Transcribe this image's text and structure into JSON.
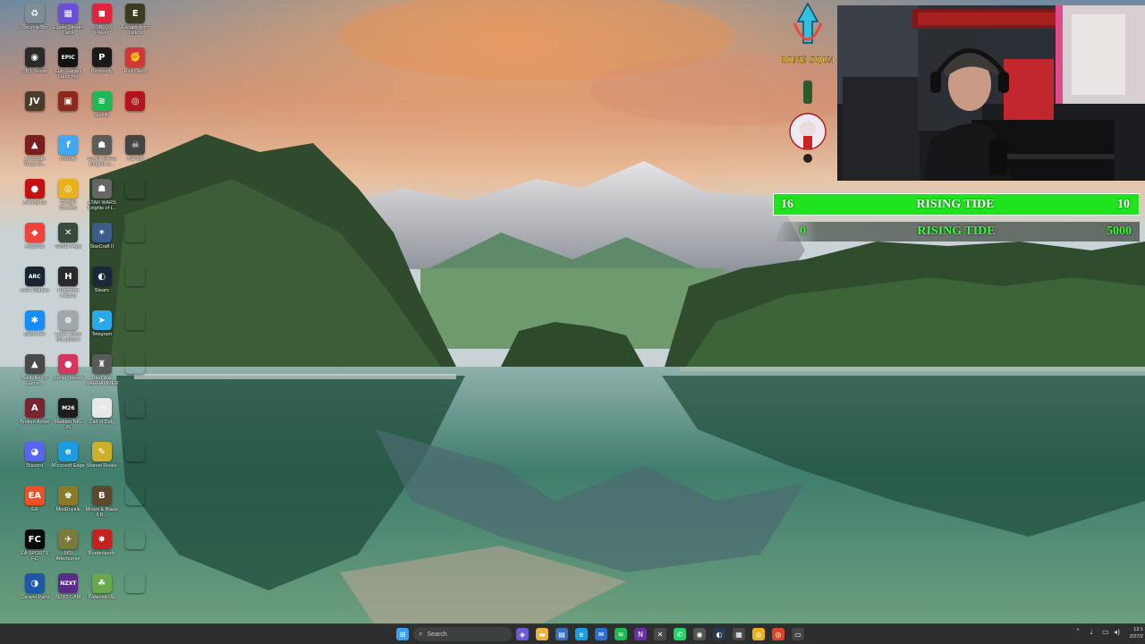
{
  "desktop": {
    "icons": [
      {
        "label": "Recycle Bin",
        "icon": "recycle-bin-icon",
        "glyph": "♻",
        "color": "#7f8d96"
      },
      {
        "label": "Elgato Stream Deck",
        "icon": "stream-deck-icon",
        "glyph": "▦",
        "color": "#6b4fd8"
      },
      {
        "label": "ROBLOX Player",
        "icon": "roblox-icon",
        "glyph": "◼",
        "color": "#e2233b"
      },
      {
        "label": "Escape from Tarkov",
        "icon": "tarkov-icon",
        "glyph": "E",
        "color": "#3d3a22"
      },
      {
        "label": "OBS Studio",
        "icon": "obs-icon",
        "glyph": "◉",
        "color": "#2a2a2a"
      },
      {
        "label": "Epic Games Launcher",
        "icon": "epic-games-icon",
        "glyph": "EPIC",
        "color": "#111"
      },
      {
        "label": "Perplexity",
        "icon": "perplexity-icon",
        "glyph": "P",
        "color": "#1a1a1a"
      },
      {
        "label": "Riot Client",
        "icon": "riot-client-icon",
        "glyph": "✊",
        "color": "#d13639"
      },
      {
        "label": "",
        "icon": "jv-icon",
        "glyph": "JV",
        "color": "#4a3d2c"
      },
      {
        "label": "",
        "icon": "game-icon",
        "glyph": "▣",
        "color": "#8a2a1c"
      },
      {
        "label": "Spotify",
        "icon": "spotify-icon",
        "glyph": "≋",
        "color": "#1db954"
      },
      {
        "label": "",
        "icon": "red-game-icon",
        "glyph": "◎",
        "color": "#b4151c"
      },
      {
        "label": "American Truck Si...",
        "icon": "american-truck-icon",
        "glyph": "▲",
        "color": "#7a1e1e"
      },
      {
        "label": "Fortnite",
        "icon": "fortnite-icon",
        "glyph": "f",
        "color": "#3fa9f5"
      },
      {
        "label": "STAR WARS Knights o...",
        "icon": "star-wars-icon",
        "glyph": "☗",
        "color": "#5b5b5b"
      },
      {
        "label": "The Isle",
        "icon": "the-isle-icon",
        "glyph": "☠",
        "color": "#444"
      },
      {
        "label": "Among Us",
        "icon": "among-us-icon",
        "glyph": "●",
        "color": "#c51111"
      },
      {
        "label": "Google Chrome",
        "icon": "chrome-icon",
        "glyph": "◎",
        "color": "#e9b21d"
      },
      {
        "label": "STAR WARS Knights of t...",
        "icon": "star-wars-2-icon",
        "glyph": "☗",
        "color": "#666"
      },
      {
        "label": "",
        "icon": "blank-icon",
        "glyph": "",
        "color": "rgba(0,0,0,0)"
      },
      {
        "label": "AnyDesk",
        "icon": "anydesk-icon",
        "glyph": "◆",
        "color": "#ef443b"
      },
      {
        "label": "GoXLR App",
        "icon": "goxlr-icon",
        "glyph": "✕",
        "color": "#3a4a3a"
      },
      {
        "label": "StarCraft II",
        "icon": "starcraft-icon",
        "glyph": "✶",
        "color": "#3b5b8a"
      },
      {
        "label": "",
        "icon": "blank-icon",
        "glyph": "",
        "color": "rgba(0,0,0,0)"
      },
      {
        "label": "ARC Raiders",
        "icon": "arc-raiders-icon",
        "glyph": "ARC",
        "color": "#1a2430"
      },
      {
        "label": "Hogwarts Legacy",
        "icon": "hogwarts-icon",
        "glyph": "H",
        "color": "#2b2b2b"
      },
      {
        "label": "Steam",
        "icon": "steam-icon",
        "glyph": "◐",
        "color": "#1b2838"
      },
      {
        "label": "",
        "icon": "blank-icon",
        "glyph": "",
        "color": "rgba(0,0,0,0)"
      },
      {
        "label": "Battle.net",
        "icon": "battlenet-icon",
        "glyph": "✱",
        "color": "#148eff"
      },
      {
        "label": "Learn about this picture",
        "icon": "learn-picture-icon",
        "glyph": "⊗",
        "color": "rgba(0,0,0,0.2)"
      },
      {
        "label": "Telegram",
        "icon": "telegram-icon",
        "glyph": "➤",
        "color": "#29a9eb"
      },
      {
        "label": "",
        "icon": "blank-icon",
        "glyph": "",
        "color": "rgba(0,0,0,0)"
      },
      {
        "label": "Battlefield 6 Game...",
        "icon": "battlefield-icon",
        "glyph": "▲",
        "color": "#4a4a4a"
      },
      {
        "label": "Lumia Stream",
        "icon": "lumia-stream-icon",
        "glyph": "●",
        "color": "#d6355e"
      },
      {
        "label": "Total War WARHAMMER",
        "icon": "total-war-icon",
        "glyph": "♜",
        "color": "#5a5a5a"
      },
      {
        "label": "",
        "icon": "blank-icon",
        "glyph": "",
        "color": "rgba(0,0,0,0)"
      },
      {
        "label": "Broken Arrow",
        "icon": "broken-arrow-icon",
        "glyph": "A",
        "color": "#7a2430"
      },
      {
        "label": "Madden NFL 26",
        "icon": "madden-icon",
        "glyph": "M26",
        "color": "#1d1d1d"
      },
      {
        "label": "Call of Duty",
        "icon": "call-of-duty-icon",
        "glyph": "▭",
        "color": "#e8e8e8"
      },
      {
        "label": "",
        "icon": "blank-icon",
        "glyph": "",
        "color": "rgba(0,0,0,0)"
      },
      {
        "label": "Discord",
        "icon": "discord-icon",
        "glyph": "◕",
        "color": "#5865f2"
      },
      {
        "label": "Microsoft Edge",
        "icon": "edge-icon",
        "glyph": "e",
        "color": "#1b9de2"
      },
      {
        "label": "Marvel Rivals",
        "icon": "marvel-rivals-icon",
        "glyph": "✎",
        "color": "#c9b12a"
      },
      {
        "label": "",
        "icon": "blank-icon",
        "glyph": "",
        "color": "rgba(0,0,0,0)"
      },
      {
        "label": "EA",
        "icon": "ea-icon",
        "glyph": "EA",
        "color": "#f04f23"
      },
      {
        "label": "MiniRoyale",
        "icon": "mini-royale-icon",
        "glyph": "♚",
        "color": "#8b7a2b"
      },
      {
        "label": "Mount & Blade II B...",
        "icon": "mount-blade-icon",
        "glyph": "B",
        "color": "#5b4a30"
      },
      {
        "label": "",
        "icon": "blank-icon",
        "glyph": "",
        "color": "rgba(0,0,0,0)"
      },
      {
        "label": "EA SPORTS FC",
        "icon": "ea-sports-fc-icon",
        "glyph": "FC",
        "color": "#0a0a0a"
      },
      {
        "label": "MSI Afterburner",
        "icon": "msi-icon",
        "glyph": "✈",
        "color": "#7a7a3a"
      },
      {
        "label": "Borderlands",
        "icon": "borderlands-icon",
        "glyph": "✸",
        "color": "#c62020"
      },
      {
        "label": "",
        "icon": "blank-icon",
        "glyph": "",
        "color": "rgba(0,0,0,0)"
      },
      {
        "label": "Caravel Parts",
        "icon": "caravel-icon",
        "glyph": "◑",
        "color": "#1f57a8"
      },
      {
        "label": "NZXT CAM",
        "icon": "nzxt-cam-icon",
        "glyph": "NZXT",
        "color": "#5b2b8a"
      },
      {
        "label": "Palworld UE",
        "icon": "palworld-icon",
        "glyph": "☘",
        "color": "#6aa84f"
      },
      {
        "label": "",
        "icon": "blank-icon",
        "glyph": "",
        "color": "rgba(0,0,0,0)"
      }
    ]
  },
  "overlay": {
    "logo_text": "CRONE SQUAD",
    "goal1": {
      "left": "16",
      "title": "RISING TIDE",
      "right": "10",
      "progress": 1.0
    },
    "goal2": {
      "left": "0",
      "title": "RISING TIDE",
      "right": "5000",
      "progress": 0.0
    }
  },
  "taskbar": {
    "search_placeholder": "Search",
    "clock_time": "12:1",
    "clock_date": "2/27/2",
    "apps": [
      {
        "icon": "start-icon",
        "glyph": "⊞",
        "color": "#3aa0f0"
      },
      {
        "icon": "widgets-icon",
        "glyph": "☁",
        "color": "#b8a34a"
      },
      {
        "icon": "copilot-icon",
        "glyph": "◈",
        "color": "#6a5bd6"
      },
      {
        "icon": "file-explorer-icon",
        "glyph": "▬",
        "color": "#e8b53a"
      },
      {
        "icon": "store-icon",
        "glyph": "▤",
        "color": "#3d6fbf"
      },
      {
        "icon": "edge-icon",
        "glyph": "e",
        "color": "#1b9de2"
      },
      {
        "icon": "mail-icon",
        "glyph": "✉",
        "color": "#2a6fd1"
      },
      {
        "icon": "spotify-icon",
        "glyph": "≋",
        "color": "#1db954"
      },
      {
        "icon": "nzxt-icon",
        "glyph": "N",
        "color": "#6d2fa8"
      },
      {
        "icon": "goxlr-icon",
        "glyph": "✕",
        "color": "#4a4a4a"
      },
      {
        "icon": "whatsapp-icon",
        "glyph": "✆",
        "color": "#25d366"
      },
      {
        "icon": "obs-icon",
        "glyph": "◉",
        "color": "#555"
      },
      {
        "icon": "steam-icon",
        "glyph": "◐",
        "color": "#2a3a55"
      },
      {
        "icon": "stream-deck-icon",
        "glyph": "▦",
        "color": "#4a4a4a"
      },
      {
        "icon": "chrome-icon",
        "glyph": "◎",
        "color": "#e9b21d"
      },
      {
        "icon": "chrome-2-icon",
        "glyph": "◎",
        "color": "#d9472b"
      },
      {
        "icon": "window-icon",
        "glyph": "▭",
        "color": "#444"
      }
    ]
  }
}
